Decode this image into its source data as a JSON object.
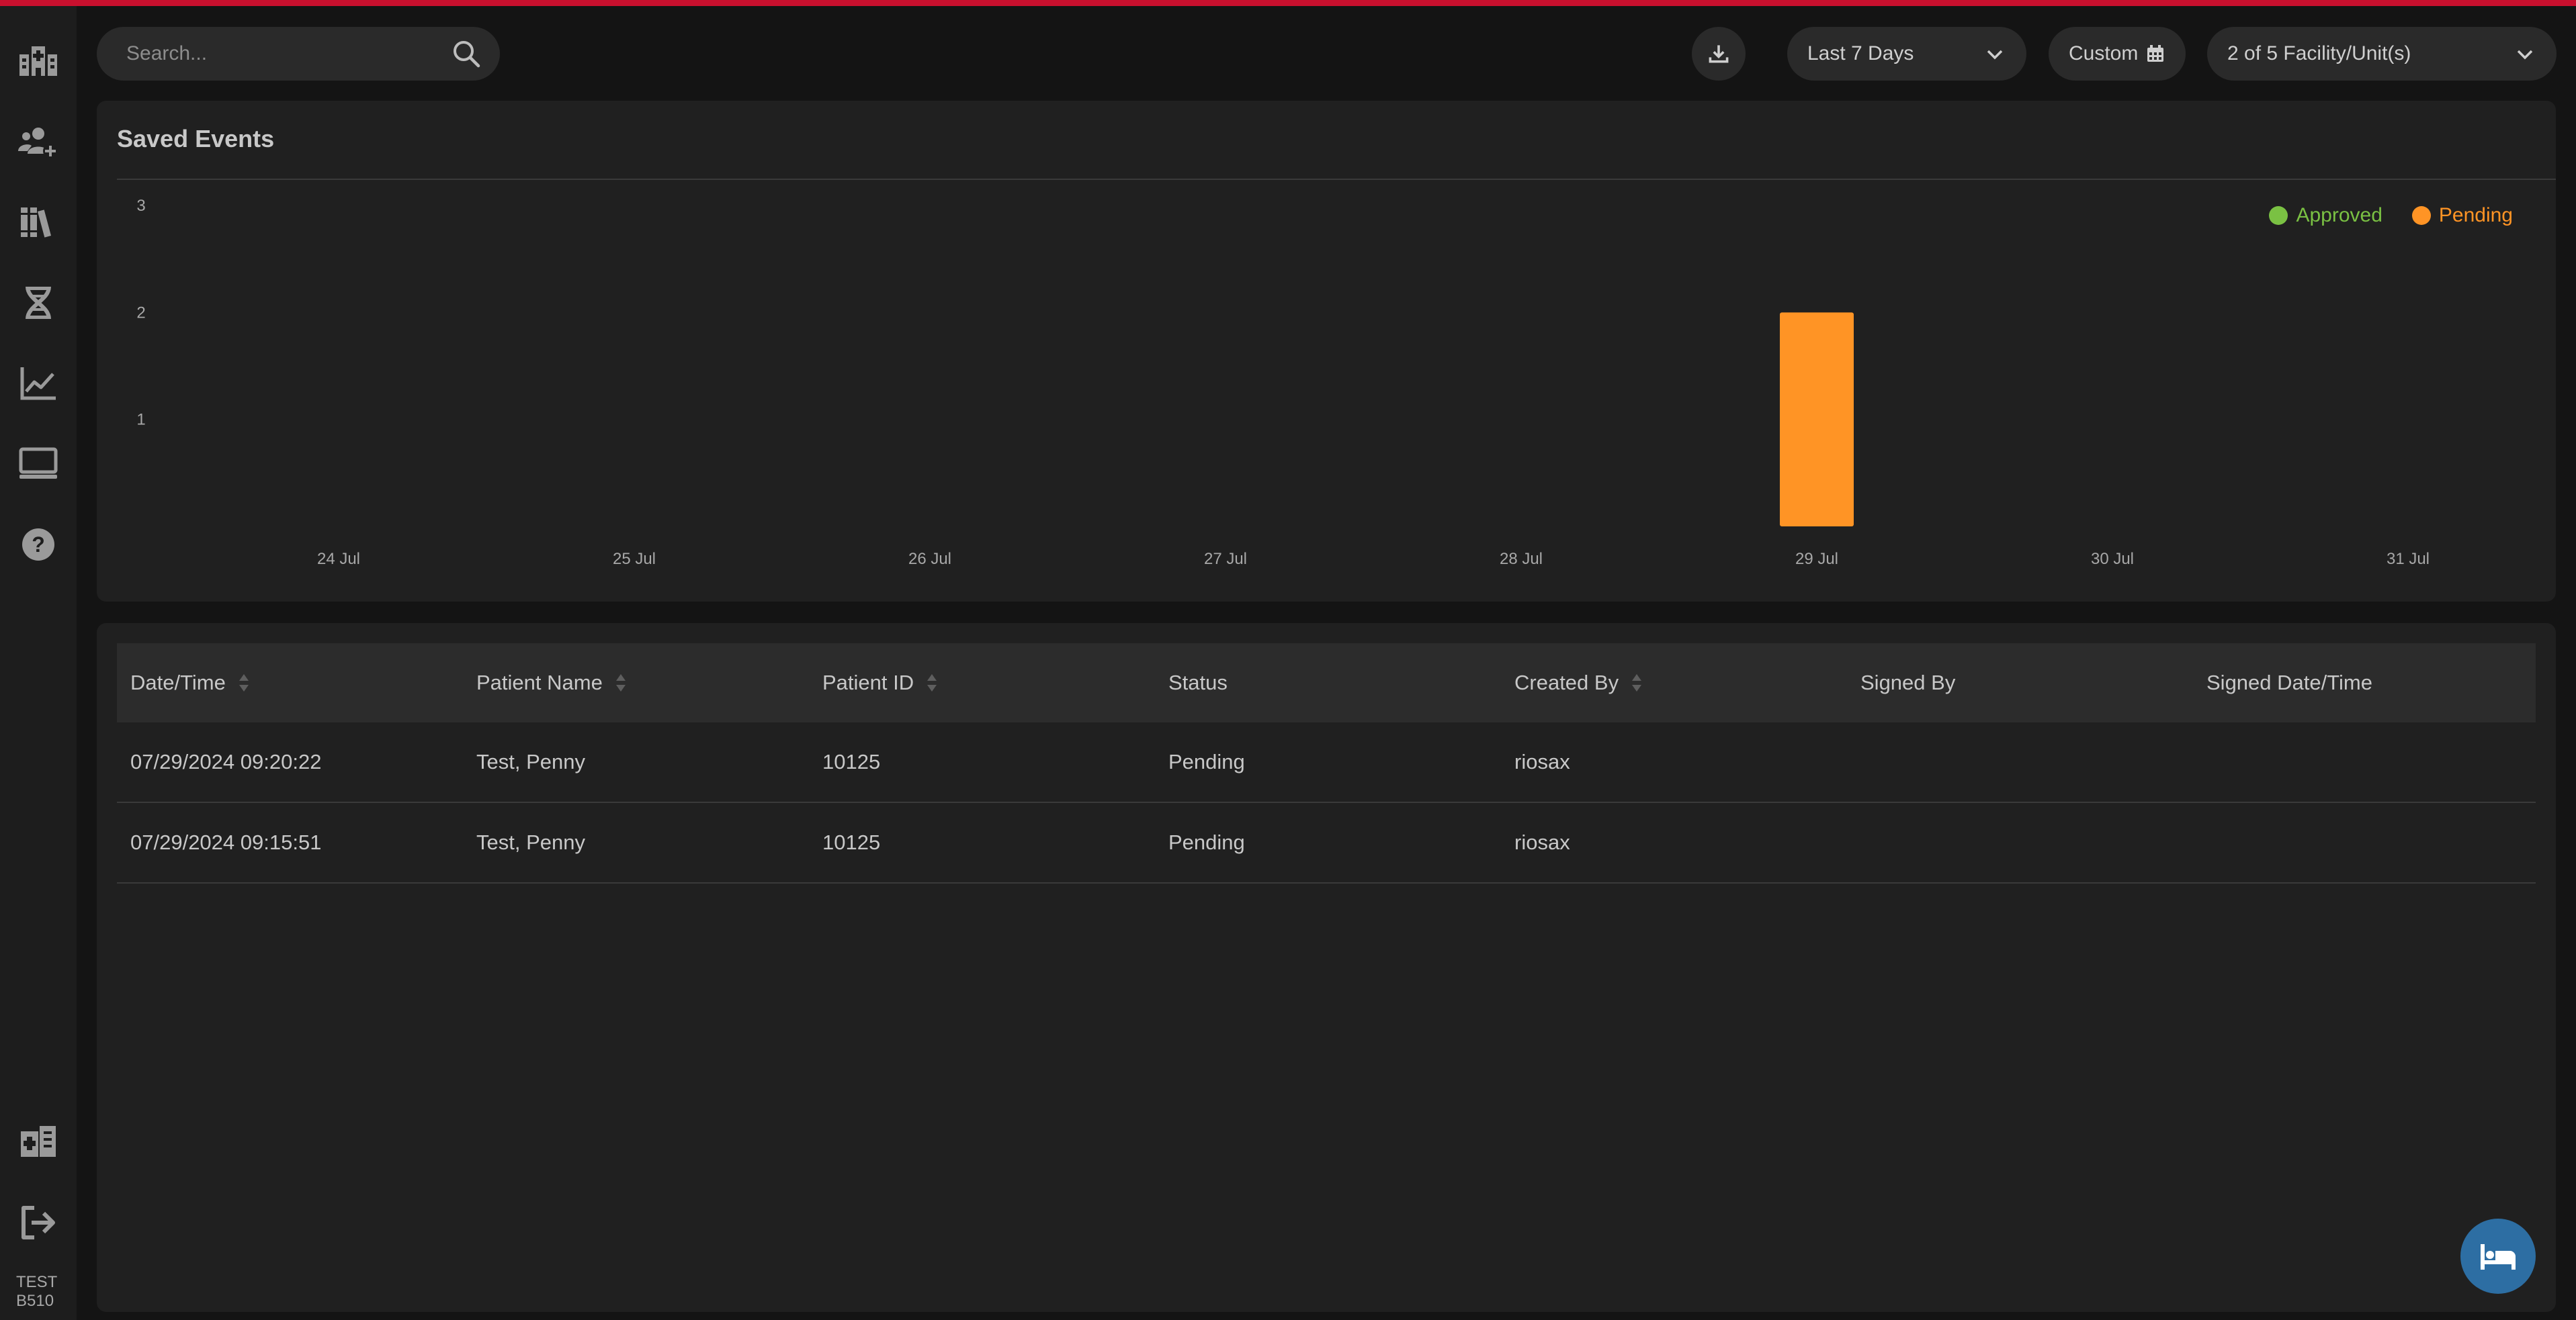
{
  "app": {
    "version_line1": "TEST",
    "version_line2": "B510"
  },
  "toolbar": {
    "search_placeholder": "Search...",
    "date_range": "Last 7 Days",
    "custom_label": "Custom",
    "facility_selector": "2 of 5 Facility/Unit(s)"
  },
  "panel": {
    "title": "Saved Events"
  },
  "colors": {
    "approved": "#7ac143",
    "pending": "#ff9425",
    "accent": "#c8102e"
  },
  "chart_data": {
    "type": "bar",
    "title": "Saved Events",
    "categories": [
      "24 Jul",
      "25 Jul",
      "26 Jul",
      "27 Jul",
      "28 Jul",
      "29 Jul",
      "30 Jul",
      "31 Jul"
    ],
    "series": [
      {
        "name": "Approved",
        "color": "#7ac143",
        "values": [
          0,
          0,
          0,
          0,
          0,
          0,
          0,
          0
        ]
      },
      {
        "name": "Pending",
        "color": "#ff9425",
        "values": [
          0,
          0,
          0,
          0,
          0,
          2,
          0,
          0
        ]
      }
    ],
    "y_ticks": [
      1,
      2,
      3
    ],
    "ylim": [
      0,
      3
    ],
    "grid": false,
    "legend": "top-right"
  },
  "table": {
    "columns": [
      {
        "label": "Date/Time",
        "sortable": true
      },
      {
        "label": "Patient Name",
        "sortable": true
      },
      {
        "label": "Patient ID",
        "sortable": true
      },
      {
        "label": "Status",
        "sortable": false
      },
      {
        "label": "Created By",
        "sortable": true
      },
      {
        "label": "Signed By",
        "sortable": false
      },
      {
        "label": "Signed Date/Time",
        "sortable": false
      }
    ],
    "rows": [
      [
        "07/29/2024 09:20:22",
        "Test, Penny",
        "10125",
        "Pending",
        "riosax",
        "",
        ""
      ],
      [
        "07/29/2024 09:15:51",
        "Test, Penny",
        "10125",
        "Pending",
        "riosax",
        "",
        ""
      ]
    ]
  }
}
